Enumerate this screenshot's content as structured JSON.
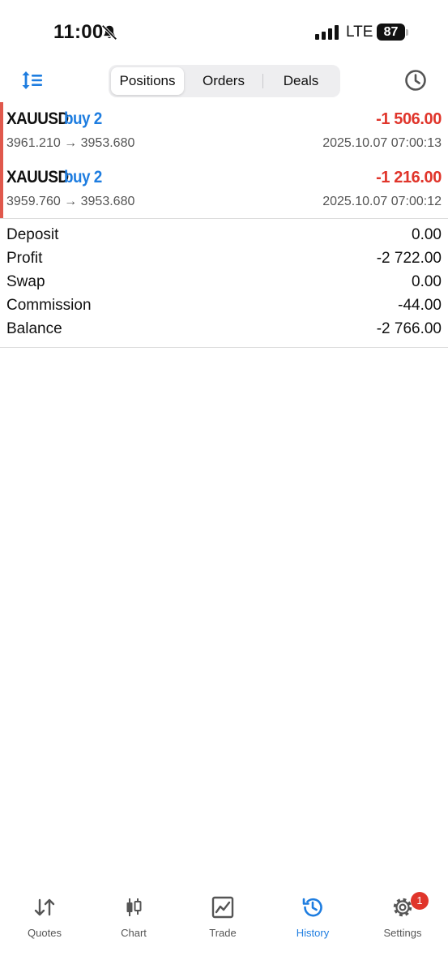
{
  "status_bar": {
    "time": "11:00",
    "network": "LTE",
    "battery": "87",
    "icons": [
      "bell-slash-icon",
      "signal-icon"
    ]
  },
  "toolbar": {
    "sort_icon": "sort-icon",
    "tabs": [
      {
        "label": "Positions",
        "active": true
      },
      {
        "label": "Orders",
        "active": false
      },
      {
        "label": "Deals",
        "active": false
      }
    ],
    "period_icon": "clock-icon"
  },
  "positions": [
    {
      "symbol": "XAUUSD",
      "direction": "buy 2",
      "profit": "-1 506.00",
      "prices": "3961.210 → 3953.680",
      "time": "2025.10.07 07:00:13"
    },
    {
      "symbol": "XAUUSD",
      "direction": "buy 2",
      "profit": "-1 216.00",
      "prices": "3959.760 → 3953.680",
      "time": "2025.10.07 07:00:12"
    }
  ],
  "summary": [
    {
      "label": "Deposit",
      "value": "0.00"
    },
    {
      "label": "Profit",
      "value": "-2 722.00"
    },
    {
      "label": "Swap",
      "value": "0.00"
    },
    {
      "label": "Commission",
      "value": "-44.00"
    },
    {
      "label": "Balance",
      "value": "-2 766.00"
    }
  ],
  "tabbar": {
    "items": [
      {
        "label": "Quotes",
        "icon": "quotes-icon",
        "active": false
      },
      {
        "label": "Chart",
        "icon": "chart-icon",
        "active": false
      },
      {
        "label": "Trade",
        "icon": "trade-icon",
        "active": false
      },
      {
        "label": "History",
        "icon": "history-icon",
        "active": true
      },
      {
        "label": "Settings",
        "icon": "settings-icon",
        "active": false,
        "badge": "1"
      }
    ]
  },
  "colors": {
    "accent": "#1e7de0",
    "loss": "#e0352b",
    "row_marker": "#e0584c"
  }
}
